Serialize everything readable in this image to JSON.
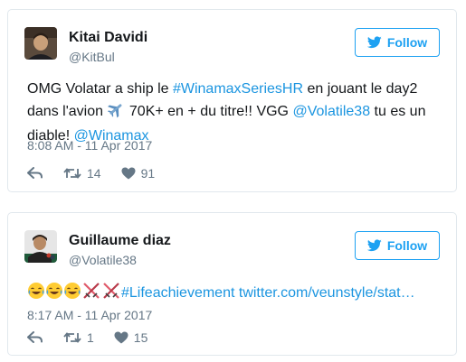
{
  "colors": {
    "link": "#1b95e0",
    "follow_accent": "#1da1f2",
    "secondary_text": "#657786",
    "border": "#e1e8ed"
  },
  "tweets": [
    {
      "author_name": "Kitai Davidi",
      "author_handle": "@KitBul",
      "follow_label": "Follow",
      "text": {
        "p1": "OMG Volatar a ship le ",
        "hashtag": "#WinamaxSeriesHR",
        "p2": " en jouant le day2 dans l'avion ",
        "emoji": "airplane",
        "p3": " 70K+ en + du titre!! VGG ",
        "mention1": "@Volatile38",
        "p4": " tu es un diable! ",
        "mention2": "@Winamax"
      },
      "timestamp": "8:08 AM - 11 Apr 2017",
      "retweets": "14",
      "likes": "91"
    },
    {
      "author_name": "Guillaume diaz",
      "author_handle": "@Volatile38",
      "follow_label": "Follow",
      "text": {
        "emojis": [
          "face-with-tears-of-joy",
          "face-with-tears-of-joy",
          "face-with-tears-of-joy",
          "crossed-swords",
          "crossed-swords"
        ],
        "hashtag": "#Lifeachievement",
        "url": "twitter.com/veunstyle/stat…"
      },
      "timestamp": "8:17 AM - 11 Apr 2017",
      "retweets": "1",
      "likes": "15"
    }
  ]
}
